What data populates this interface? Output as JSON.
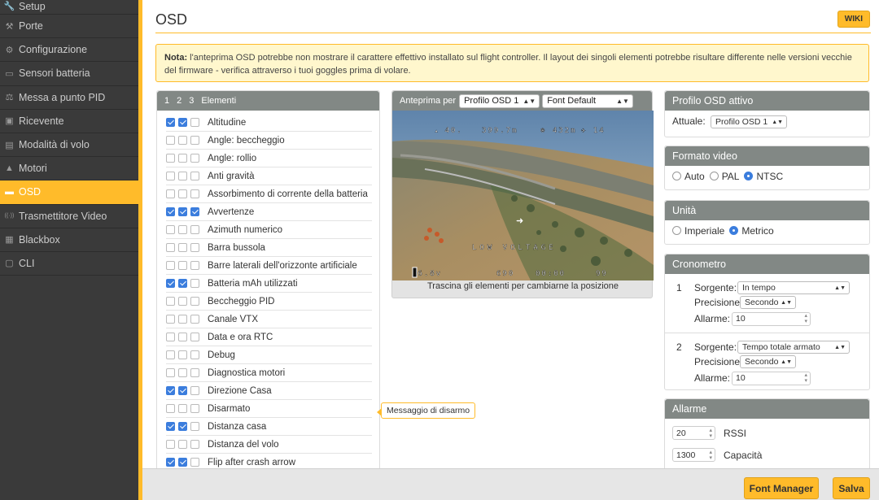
{
  "sidebar": {
    "items": [
      {
        "label": "Setup",
        "icon": "wrench-icon",
        "glyph": "🔧"
      },
      {
        "label": "Porte",
        "icon": "plug-icon",
        "glyph": "⚒"
      },
      {
        "label": "Configurazione",
        "icon": "gear-icon",
        "glyph": "⚙"
      },
      {
        "label": "Sensori batteria",
        "icon": "battery-icon",
        "glyph": "▭"
      },
      {
        "label": "Messa a punto PID",
        "icon": "sliders-icon",
        "glyph": "⚖"
      },
      {
        "label": "Ricevente",
        "icon": "receiver-icon",
        "glyph": "▣"
      },
      {
        "label": "Modalità di volo",
        "icon": "flight-mode-icon",
        "glyph": "▤"
      },
      {
        "label": "Motori",
        "icon": "motor-icon",
        "glyph": "▲"
      },
      {
        "label": "OSD",
        "icon": "osd-icon",
        "glyph": "▬"
      },
      {
        "label": "Trasmettitore Video",
        "icon": "broadcast-icon",
        "glyph": "((·))"
      },
      {
        "label": "Blackbox",
        "icon": "blackbox-icon",
        "glyph": "▦"
      },
      {
        "label": "CLI",
        "icon": "terminal-icon",
        "glyph": "▢"
      }
    ],
    "active_index": 8
  },
  "page": {
    "title": "OSD",
    "wiki_label": "WIKI",
    "note_bold": "Nota:",
    "note_text": " l'anteprima OSD potrebbe non mostrare il carattere effettivo installato sul flight controller. Il layout dei singoli elementi potrebbe risultare differente nelle versioni vecchie del firmware - verifica attraverso i tuoi goggles prima di volare."
  },
  "elements_panel": {
    "headers": [
      "1",
      "2",
      "3",
      "Elementi"
    ],
    "rows": [
      {
        "label": "Altitudine",
        "checks": [
          true,
          true,
          false
        ]
      },
      {
        "label": "Angle: beccheggio",
        "checks": [
          false,
          false,
          false
        ]
      },
      {
        "label": "Angle: rollio",
        "checks": [
          false,
          false,
          false
        ]
      },
      {
        "label": "Anti gravità",
        "checks": [
          false,
          false,
          false
        ]
      },
      {
        "label": "Assorbimento di corrente della batteria",
        "checks": [
          false,
          false,
          false
        ]
      },
      {
        "label": "Avvertenze",
        "checks": [
          true,
          true,
          true
        ]
      },
      {
        "label": "Azimuth numerico",
        "checks": [
          false,
          false,
          false
        ]
      },
      {
        "label": "Barra bussola",
        "checks": [
          false,
          false,
          false
        ]
      },
      {
        "label": "Barre laterali dell'orizzonte artificiale",
        "checks": [
          false,
          false,
          false
        ]
      },
      {
        "label": "Batteria mAh utilizzati",
        "checks": [
          true,
          true,
          false
        ]
      },
      {
        "label": "Beccheggio PID",
        "checks": [
          false,
          false,
          false
        ]
      },
      {
        "label": "Canale VTX",
        "checks": [
          false,
          false,
          false
        ]
      },
      {
        "label": "Data e ora RTC",
        "checks": [
          false,
          false,
          false
        ]
      },
      {
        "label": "Debug",
        "checks": [
          false,
          false,
          false
        ]
      },
      {
        "label": "Diagnostica motori",
        "checks": [
          false,
          false,
          false
        ]
      },
      {
        "label": "Direzione Casa",
        "checks": [
          true,
          true,
          false
        ]
      },
      {
        "label": "Disarmato",
        "checks": [
          false,
          false,
          false
        ]
      },
      {
        "label": "Distanza casa",
        "checks": [
          true,
          true,
          false
        ]
      },
      {
        "label": "Distanza del volo",
        "checks": [
          false,
          false,
          false
        ]
      },
      {
        "label": "Flip after crash arrow",
        "checks": [
          true,
          true,
          false
        ]
      }
    ]
  },
  "tooltip": {
    "text": "Messaggio di disarmo"
  },
  "preview": {
    "label": "Anteprima per",
    "profile_select": "Profilo OSD 1",
    "font_select": "Font Default",
    "caption": "Trascina gli elementi per cambiarne la posizione",
    "osd": {
      "alt": "40.",
      "dist": "399.7m",
      "home": "432m",
      "sats": "14",
      "warning": "LOW VOLTAGE",
      "voltage": "16.8v",
      "mah": "690",
      "time": "00:00",
      "rssi": "99"
    }
  },
  "right": {
    "active_profile": {
      "title": "Profilo OSD attivo",
      "label": "Attuale:",
      "value": "Profilo OSD 1"
    },
    "video_format": {
      "title": "Formato video",
      "options": [
        "Auto",
        "PAL",
        "NTSC"
      ],
      "selected": "NTSC"
    },
    "units": {
      "title": "Unità",
      "options": [
        "Imperiale",
        "Metrico"
      ],
      "selected": "Metrico"
    },
    "timers": {
      "title": "Cronometro",
      "items": [
        {
          "index": "1",
          "source_label": "Sorgente:",
          "source": "In tempo",
          "precision_label": "Precisione",
          "precision": "Secondo",
          "alarm_label": "Allarme:",
          "alarm": "10"
        },
        {
          "index": "2",
          "source_label": "Sorgente:",
          "source": "Tempo totale armato",
          "precision_label": "Precisione",
          "precision": "Secondo",
          "alarm_label": "Allarme:",
          "alarm": "10"
        }
      ]
    },
    "alarms": {
      "title": "Allarme",
      "items": [
        {
          "value": "20",
          "label": "RSSI"
        },
        {
          "value": "1300",
          "label": "Capacità"
        }
      ]
    }
  },
  "buttons": {
    "font_manager": "Font Manager",
    "save": "Salva"
  },
  "colors": {
    "accent": "#ffbb2a",
    "panel_header": "#828885",
    "checkbox_on": "#3b7ddd",
    "sidebar_bg": "#3a3a3a"
  }
}
